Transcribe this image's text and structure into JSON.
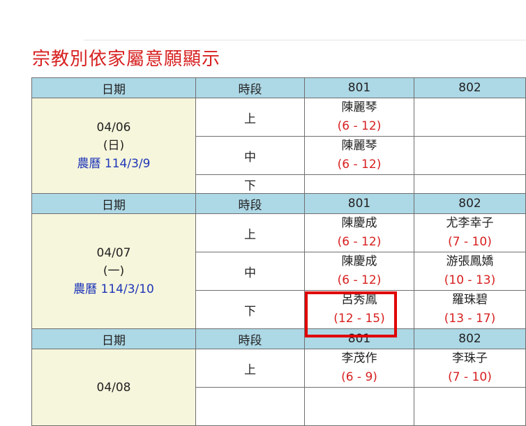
{
  "page": {
    "title": "宗教別依家屬意願顯示"
  },
  "headers": {
    "date": "日期",
    "period": "時段",
    "col801": "801",
    "col802": "802"
  },
  "days": [
    {
      "date": "04/06",
      "weekday": "(日)",
      "lunar": "農曆 114/3/9",
      "slots": [
        {
          "period": "上",
          "c801": {
            "name": "陳麗琴",
            "range": "(6 - 12)"
          },
          "c802": {
            "name": "",
            "range": ""
          }
        },
        {
          "period": "中",
          "c801": {
            "name": "陳麗琴",
            "range": "(6 - 12)"
          },
          "c802": {
            "name": "",
            "range": ""
          }
        },
        {
          "period": "下",
          "c801": {
            "name": "",
            "range": ""
          },
          "c802": {
            "name": "",
            "range": ""
          }
        }
      ]
    },
    {
      "date": "04/07",
      "weekday": "(一)",
      "lunar": "農曆 114/3/10",
      "slots": [
        {
          "period": "上",
          "c801": {
            "name": "陳慶成",
            "range": "(6 - 12)"
          },
          "c802": {
            "name": "尤李幸子",
            "range": "(7 - 10)"
          }
        },
        {
          "period": "中",
          "c801": {
            "name": "陳慶成",
            "range": "(6 - 12)"
          },
          "c802": {
            "name": "游張鳳嬌",
            "range": "(10 - 13)"
          }
        },
        {
          "period": "下",
          "c801": {
            "name": "呂秀鳳",
            "range": "(12 - 15)"
          },
          "c802": {
            "name": "羅珠碧",
            "range": "(13 - 17)"
          }
        }
      ]
    },
    {
      "date": "04/08",
      "weekday": "",
      "lunar": "",
      "slots": [
        {
          "period": "上",
          "c801": {
            "name": "李茂作",
            "range": "(6 - 9)"
          },
          "c802": {
            "name": "李珠子",
            "range": "(7 - 10)"
          }
        },
        {
          "period": "",
          "c801": {
            "name": "",
            "range": ""
          },
          "c802": {
            "name": "",
            "range": ""
          }
        }
      ]
    }
  ],
  "colors": {
    "title": "#d72020",
    "header_bg": "#add8e6",
    "date_bg": "#f6f6dc",
    "range": "#d72020",
    "lunar": "#1f36b8",
    "highlight": "#e00000"
  }
}
